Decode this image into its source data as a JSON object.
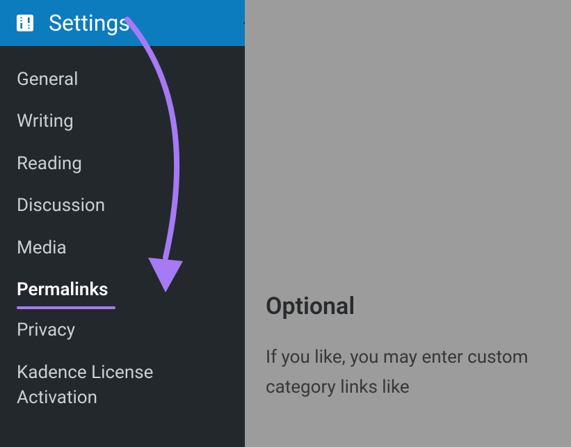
{
  "sidebar": {
    "header": {
      "title": "Settings",
      "icon": "sliders-icon"
    },
    "items": [
      {
        "label": "General"
      },
      {
        "label": "Writing"
      },
      {
        "label": "Reading"
      },
      {
        "label": "Discussion"
      },
      {
        "label": "Media"
      },
      {
        "label": "Permalinks",
        "active": true
      },
      {
        "label": "Privacy"
      },
      {
        "label": "Kadence License Activation"
      }
    ]
  },
  "main": {
    "heading": "Optional",
    "body_line1": "If you like, you may enter custom",
    "body_line2": "category links like"
  },
  "annotation": {
    "arrow_color": "#a679f5",
    "underline_color": "#a679f5"
  }
}
